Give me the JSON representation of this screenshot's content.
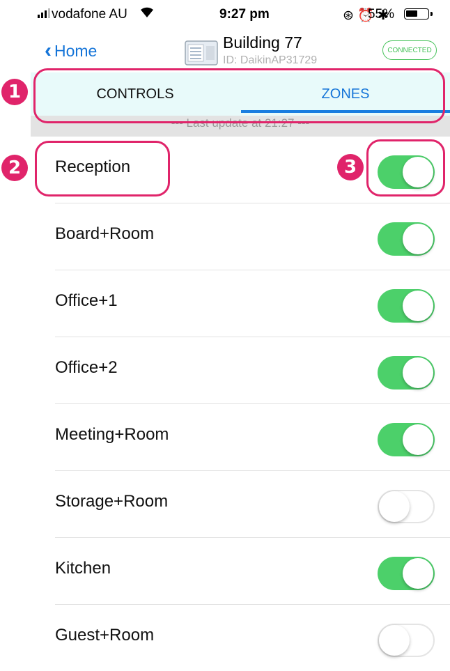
{
  "status_bar": {
    "carrier": "vodafone AU",
    "time": "9:27 pm",
    "icons": [
      "orientation-lock-icon",
      "alarm-icon",
      "bluetooth-icon"
    ],
    "battery_percent": "55%",
    "battery_level": 0.55
  },
  "nav": {
    "back_label": "Home",
    "title": "Building 77",
    "subtitle": "ID: DaikinAP31729",
    "connection_badge": "CONNECTED",
    "unit_icon": "ac-unit-icon"
  },
  "tabs": [
    {
      "label": "CONTROLS",
      "selected": false
    },
    {
      "label": "ZONES",
      "selected": true
    }
  ],
  "last_update": "--- Last update at 21:27 ---",
  "zones": [
    {
      "name": "Reception",
      "on": true
    },
    {
      "name": "Board+Room",
      "on": true
    },
    {
      "name": "Office+1",
      "on": true
    },
    {
      "name": "Office+2",
      "on": true
    },
    {
      "name": "Meeting+Room",
      "on": true
    },
    {
      "name": "Storage+Room",
      "on": false
    },
    {
      "name": "Kitchen",
      "on": true
    },
    {
      "name": "Guest+Room",
      "on": false
    }
  ],
  "annotations": [
    {
      "number": "1"
    },
    {
      "number": "2"
    },
    {
      "number": "3"
    }
  ],
  "colors": {
    "accent": "#1474d8",
    "toggle_on": "#4cd06a",
    "connected": "#47c25a",
    "annotation": "#e0246a",
    "segment_bg": "#e8fafa"
  }
}
